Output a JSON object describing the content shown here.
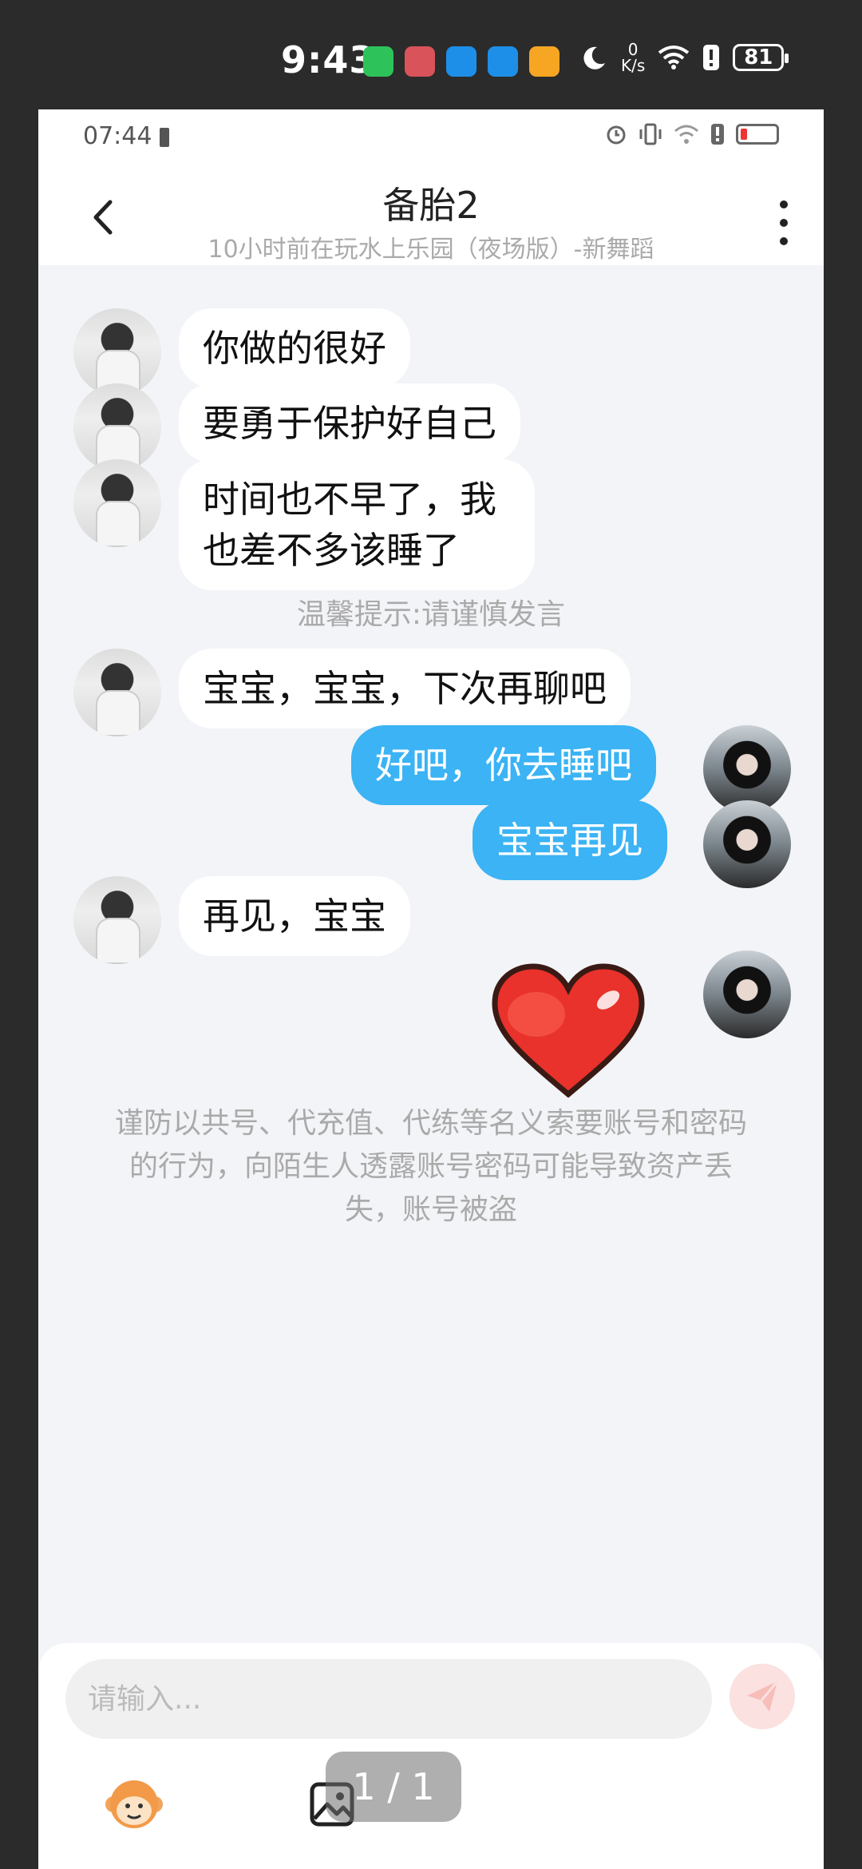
{
  "outer_status": {
    "time": "9:43",
    "net_speed_value": "0",
    "net_speed_unit": "K/s",
    "battery": "81",
    "app_icons": [
      "wechat-icon",
      "game-app-icon",
      "cloud-app-icon",
      "cloud-app-icon-2",
      "orange-app-icon"
    ]
  },
  "inner_status": {
    "time": "07:44"
  },
  "header": {
    "title": "备胎2",
    "subtitle": "10小时前在玩水上乐园（夜场版）-新舞蹈"
  },
  "messages": [
    {
      "side": "left",
      "text": "你做的很好"
    },
    {
      "side": "left",
      "text": "要勇于保护好自己"
    },
    {
      "side": "left",
      "text": "时间也不早了，我也差不多该睡了"
    },
    {
      "side": "left",
      "text": "宝宝，宝宝，下次再聊吧"
    },
    {
      "side": "right",
      "text": "好吧，你去睡吧"
    },
    {
      "side": "right",
      "text": "宝宝再见"
    },
    {
      "side": "left",
      "text": "再见，宝宝"
    }
  ],
  "tip": "温馨提示:请谨慎发言",
  "warning": "谨防以共号、代充值、代练等名义索要账号和密码的行为，向陌生人透露账号密码可能导致资产丢失，账号被盗",
  "input": {
    "placeholder": "请输入..."
  },
  "page_counter": "1 / 1",
  "colors": {
    "bubble_right": "#3bb3f4",
    "bubble_left": "#ffffff",
    "background": "#f3f4f7",
    "heart": "#e8322b"
  }
}
